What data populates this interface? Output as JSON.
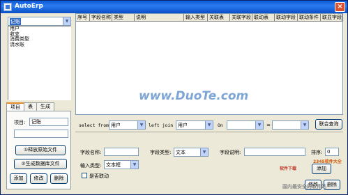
{
  "window": {
    "title": "AutoErp",
    "close_glyph": "×"
  },
  "left": {
    "combo_value": "记账",
    "list_items": [
      "用户",
      "收支",
      "消费类型",
      "流水账"
    ],
    "tabs": [
      "项目",
      "表",
      "生成"
    ],
    "project_label": "项目:",
    "project_value": "记账",
    "buttons": {
      "release": "①释放原始文件",
      "generate": "②生成数据库文件",
      "add": "添加",
      "edit": "修改",
      "delete": "删除"
    }
  },
  "grid": {
    "columns": [
      "序号",
      "字段名称",
      "类型",
      "说明",
      "输入类型",
      "关联表",
      "关联字段",
      "联动表",
      "联动字段",
      "联动条件",
      "联显字段"
    ]
  },
  "query": {
    "select_from_label": "select from",
    "select_from_value": "用户",
    "left_join_label": "left join",
    "left_join_value": "用户",
    "on_label": "On",
    "on_left_value": "",
    "equals_label": "=",
    "on_right_value": "",
    "button": "联合查询"
  },
  "field_editor": {
    "field_name_label": "字段名称:",
    "field_name_value": "",
    "field_type_label": "字段类型:",
    "field_type_value": "文本",
    "field_desc_label": "字段说明:",
    "field_desc_value": "",
    "order_label": "排序:",
    "order_value": "0",
    "input_type_label": "输入类型:",
    "input_type_value": "文本框",
    "linked_label": "是否联动",
    "linked_checked": false,
    "add_button": "添加",
    "edit_button": "修改",
    "delete_button": "删除"
  },
  "watermark": {
    "center": "www.DuoTe.com",
    "bottom_right": "2345软件大全",
    "bottom_right_sub": "国内最安全的软件站",
    "bottom_left": "软件下载"
  },
  "colors": {
    "titlebar": "#0a5bd8",
    "window_bg": "#ece9d8",
    "selection": "#316ac5",
    "border_blue": "#7f9db9",
    "watermark_blue": "#4a7fc1"
  }
}
